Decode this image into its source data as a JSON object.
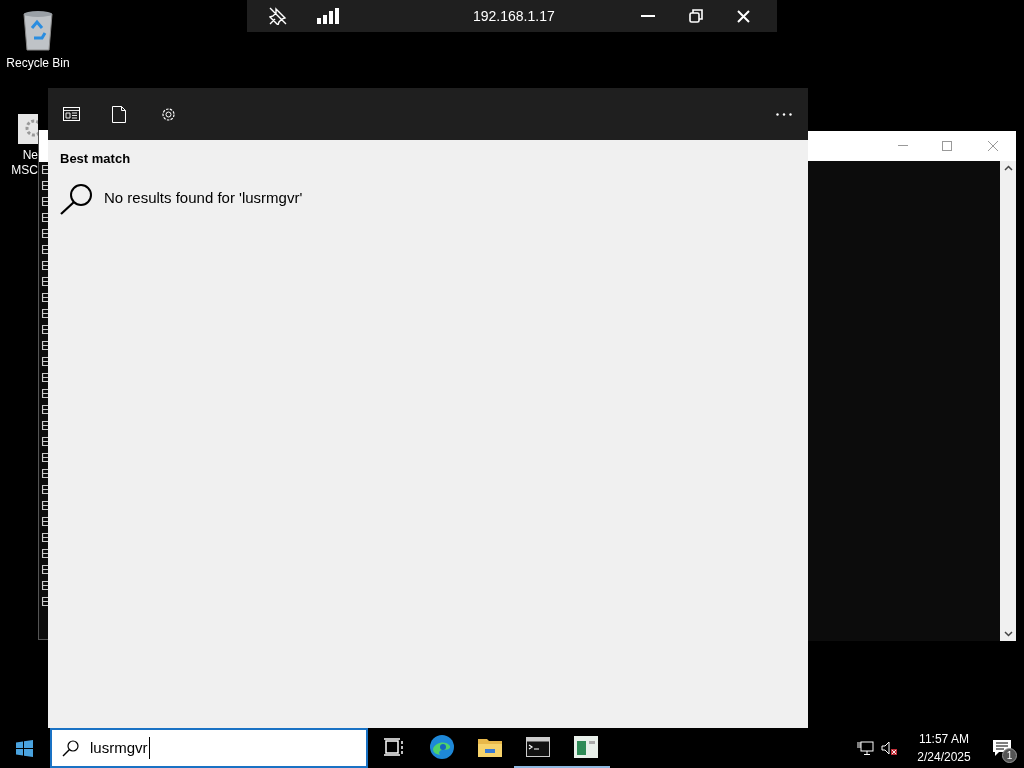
{
  "desktop_icons": [
    {
      "kind": "recycle",
      "label": "Recycle Bin"
    },
    {
      "kind": "settings",
      "label": "Ne\nMSC"
    }
  ],
  "console_window": {
    "lines": [
      "E",
      "E",
      "E",
      "E",
      "E",
      "E",
      "E",
      "E",
      "E",
      "E",
      "E",
      "E",
      "E",
      "E",
      "E",
      "E",
      "E",
      "E",
      "E",
      "E",
      "E",
      "E",
      "E",
      "E",
      "E",
      "E",
      "E",
      "E"
    ]
  },
  "remote_toolbar": {
    "title": "192.168.1.17"
  },
  "search_panel": {
    "section_title": "Best match",
    "message": "No results found for 'lusrmgvr'"
  },
  "taskbar": {
    "search_value": "lusrmgvr",
    "apps": [
      {
        "kind": "taskview",
        "running": false
      },
      {
        "kind": "browser",
        "running": false
      },
      {
        "kind": "folder",
        "running": false
      },
      {
        "kind": "terminal",
        "running": true
      },
      {
        "kind": "server",
        "running": true
      }
    ],
    "time": "11:57 AM",
    "date": "2/24/2025",
    "notification_count": "1"
  }
}
